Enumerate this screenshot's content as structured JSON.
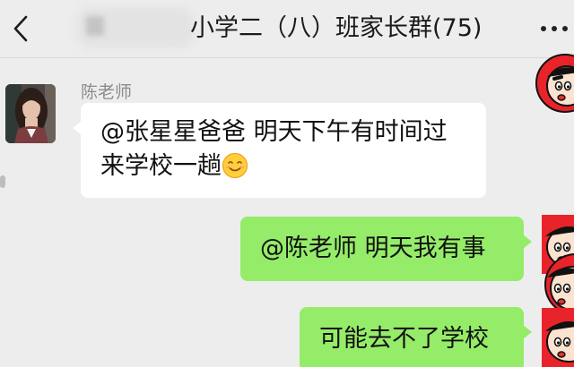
{
  "header": {
    "group_title": "小学二（八）班家长群(75)",
    "back_icon": "chevron-left-icon",
    "more_icon": "more-dots-icon"
  },
  "messages": [
    {
      "direction": "incoming",
      "sender": "陈老师",
      "line1": "@张星星爸爸 明天下午有时间过",
      "line2": "来学校一趟",
      "emoji": "smile-emoji"
    },
    {
      "direction": "outgoing",
      "text": "@陈老师 明天我有事"
    },
    {
      "direction": "outgoing",
      "text": "可能去不了学校"
    }
  ],
  "colors": {
    "background": "#ededed",
    "outgoing_bubble": "#95ec69",
    "incoming_bubble": "#ffffff",
    "sender_name": "#8c8c8c",
    "avatar_red": "#e8232a"
  }
}
